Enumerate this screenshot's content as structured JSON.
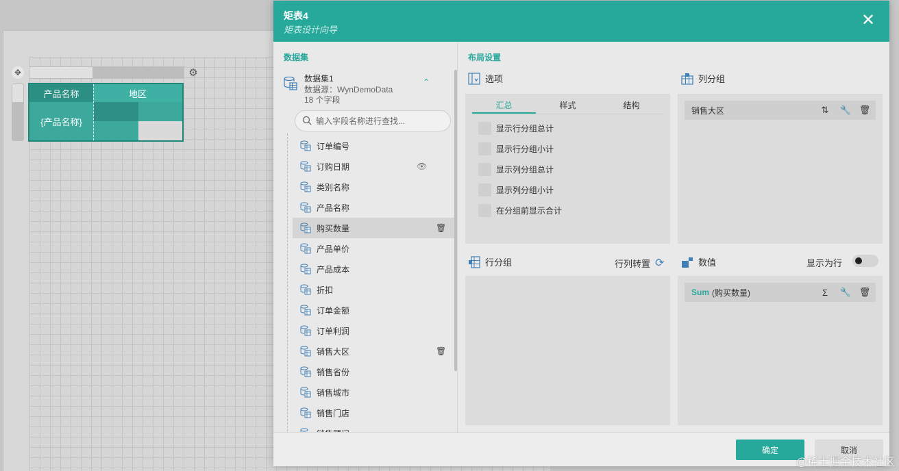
{
  "designer": {
    "matrix": {
      "row_header": "产品名称",
      "column_header": "地区",
      "row_field": "{产品名称}"
    }
  },
  "dialog": {
    "title": "矩表4",
    "subtitle": "矩表设计向导",
    "close_icon": "close-icon",
    "dataset_section": {
      "title": "数据集",
      "dataset_name": "数据集1",
      "data_source": "数据源：WynDemoData",
      "field_count": "18 个字段",
      "search_placeholder": "输入字段名称进行查找...",
      "fields": [
        {
          "label": "订单编号",
          "action": ""
        },
        {
          "label": "订购日期",
          "action": "eye-icon"
        },
        {
          "label": "类别名称",
          "action": ""
        },
        {
          "label": "产品名称",
          "action": ""
        },
        {
          "label": "购买数量",
          "action": "trash-icon",
          "active": true
        },
        {
          "label": "产品单价",
          "action": ""
        },
        {
          "label": "产品成本",
          "action": ""
        },
        {
          "label": "折扣",
          "action": ""
        },
        {
          "label": "订单金额",
          "action": ""
        },
        {
          "label": "订单利润",
          "action": ""
        },
        {
          "label": "销售大区",
          "action": "trash-icon"
        },
        {
          "label": "销售省份",
          "action": ""
        },
        {
          "label": "销售城市",
          "action": ""
        },
        {
          "label": "销售门店",
          "action": ""
        },
        {
          "label": "销售顾问",
          "action": ""
        }
      ]
    },
    "layout_section": {
      "title": "布局设置",
      "options": {
        "title": "选项",
        "tabs": [
          "汇总",
          "样式",
          "结构"
        ],
        "active_tab": 0,
        "checkboxes": [
          "显示行分组总计",
          "显示行分组小计",
          "显示列分组总计",
          "显示列分组小计",
          "在分组前显示合计"
        ]
      },
      "column_groups": {
        "title": "列分组",
        "items": [
          {
            "label": "销售大区"
          }
        ]
      },
      "row_groups": {
        "title": "行分组",
        "swap_label": "行列转置"
      },
      "values": {
        "title": "数值",
        "show_as_row_label": "显示为行",
        "show_as_row": false,
        "items": [
          {
            "aggregate": "Sum",
            "field": "(购买数量)"
          }
        ]
      }
    },
    "footer": {
      "ok_label": "确定",
      "cancel_label": "取消"
    }
  },
  "watermark": "@稀土掘金技术社区",
  "colors": {
    "accent": "#26a89a",
    "header": "#26a89a",
    "icon_blue": "#3f7fb7"
  }
}
